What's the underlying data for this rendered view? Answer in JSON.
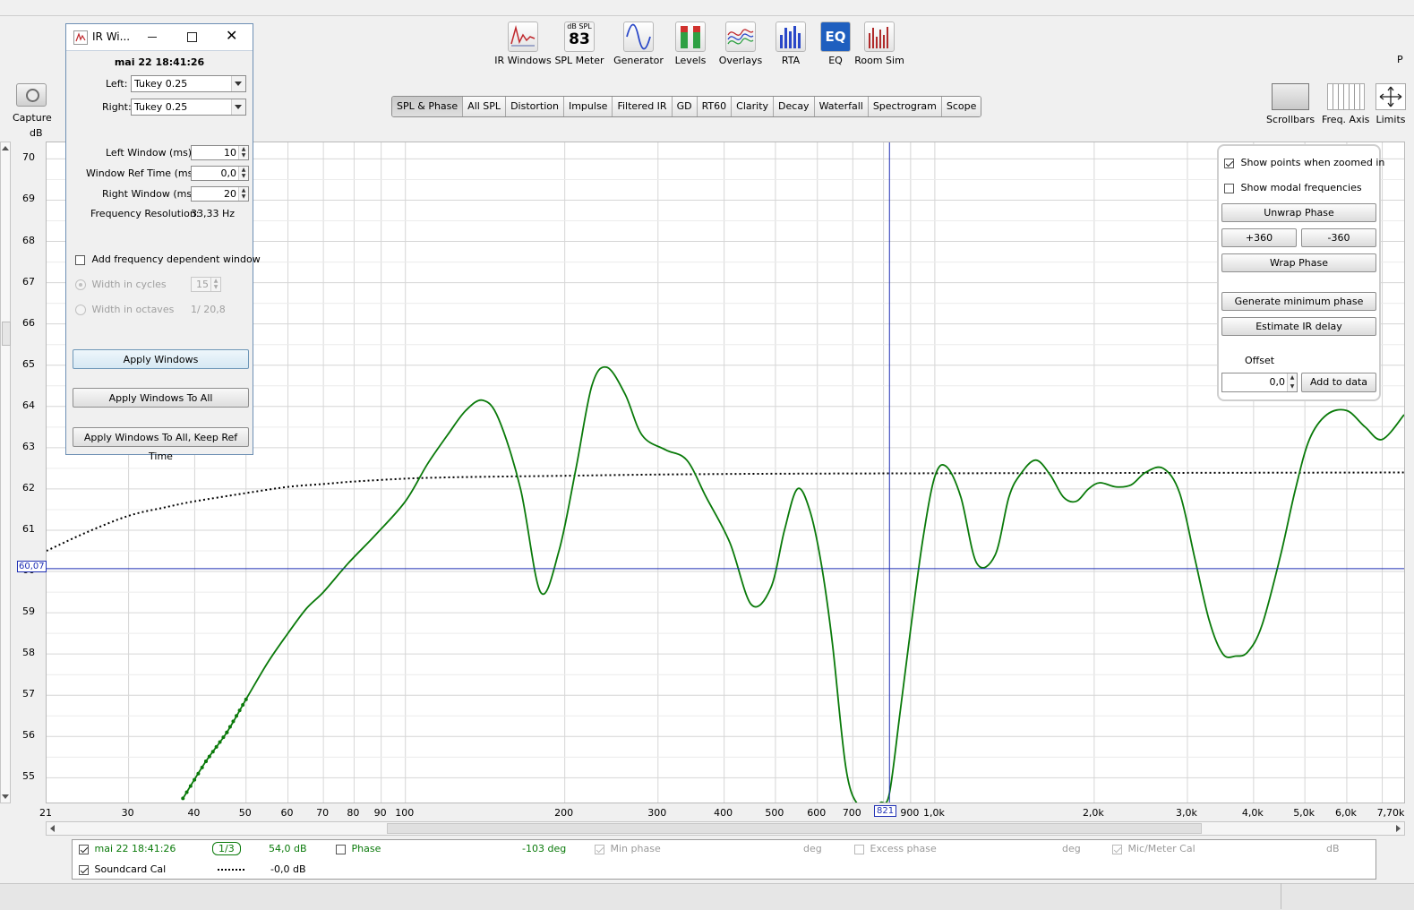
{
  "toolbar": {
    "tools": [
      {
        "label": "IR Windows",
        "icon": "ir-windows-icon"
      },
      {
        "label": "SPL Meter",
        "icon": "spl-meter-icon",
        "meter_top": "dB SPL",
        "meter_value": "83"
      },
      {
        "label": "Generator",
        "icon": "generator-icon"
      },
      {
        "label": "Levels",
        "icon": "levels-icon"
      },
      {
        "label": "Overlays",
        "icon": "overlays-icon"
      },
      {
        "label": "RTA",
        "icon": "rta-icon"
      },
      {
        "label": "EQ",
        "icon": "eq-icon",
        "icon_text": "EQ"
      },
      {
        "label": "Room Sim",
        "icon": "room-sim-icon"
      }
    ],
    "capture": "Capture",
    "truncated_right": "P"
  },
  "tabs": [
    "SPL & Phase",
    "All SPL",
    "Distortion",
    "Impulse",
    "Filtered IR",
    "GD",
    "RT60",
    "Clarity",
    "Decay",
    "Waterfall",
    "Spectrogram",
    "Scope"
  ],
  "active_tab": "SPL & Phase",
  "right_tools": {
    "scrollbars": "Scrollbars",
    "freq_axis": "Freq. Axis",
    "limits": "Limits"
  },
  "chart_data": {
    "type": "line",
    "ylabel": "dB",
    "xscale": "log",
    "xlim": [
      21,
      7700
    ],
    "ylim": [
      54.4,
      70.4
    ],
    "yticks": [
      "70",
      "69",
      "68",
      "67",
      "66",
      "65",
      "64",
      "63",
      "62",
      "61",
      "60",
      "59",
      "58",
      "57",
      "56",
      "55"
    ],
    "xtick_labels": [
      "21",
      "30",
      "40",
      "50",
      "60",
      "70",
      "80",
      "90",
      "100",
      "200",
      "300",
      "400",
      "500",
      "600",
      "700",
      "900",
      "1,0k",
      "2,0k",
      "3,0k",
      "4,0k",
      "5,0k",
      "6,0k",
      "7,70k"
    ],
    "grid": true,
    "cursor": {
      "x_label": "821",
      "y_label": "60,07",
      "x": 821,
      "y": 60.07
    },
    "series": [
      {
        "name": "mai 22 18:41:26",
        "color": "#0a7a0a",
        "style": "solid",
        "x": [
          38,
          42,
          46,
          50,
          55,
          60,
          65,
          70,
          78,
          88,
          100,
          110,
          120,
          130,
          140,
          150,
          165,
          180,
          195,
          210,
          225,
          240,
          260,
          280,
          310,
          340,
          370,
          410,
          450,
          490,
          520,
          550,
          580,
          610,
          640,
          680,
          720,
          760,
          790,
          820,
          860,
          900,
          950,
          1000,
          1050,
          1120,
          1200,
          1300,
          1380,
          1450,
          1550,
          1650,
          1750,
          1850,
          1950,
          2050,
          2200,
          2350,
          2500,
          2700,
          2900,
          3100,
          3300,
          3500,
          3700,
          3900,
          4150,
          4500,
          4800,
          5100,
          5500,
          6000,
          6500,
          7000,
          7700
        ],
        "y": [
          54.5,
          55.4,
          56.1,
          56.9,
          57.8,
          58.5,
          59.1,
          59.5,
          60.2,
          60.9,
          61.7,
          62.6,
          63.3,
          63.9,
          64.15,
          63.7,
          62.0,
          59.5,
          60.5,
          62.5,
          64.5,
          64.95,
          64.3,
          63.3,
          62.95,
          62.7,
          61.8,
          60.7,
          59.2,
          59.6,
          61.0,
          62.0,
          61.5,
          60.2,
          58.3,
          55.2,
          54.3,
          54.3,
          54.4,
          54.6,
          56.6,
          58.6,
          60.8,
          62.3,
          62.55,
          61.8,
          60.2,
          60.4,
          61.8,
          62.35,
          62.7,
          62.35,
          61.8,
          61.7,
          62.0,
          62.15,
          62.05,
          62.1,
          62.4,
          62.5,
          61.9,
          60.3,
          58.8,
          58.0,
          57.95,
          58.05,
          58.7,
          60.4,
          62.0,
          63.2,
          63.8,
          63.9,
          63.5,
          63.2,
          63.8
        ]
      },
      {
        "name": "Soundcard Cal",
        "color": "#000000",
        "style": "dotted",
        "x": [
          21,
          25,
          30,
          35,
          40,
          50,
          60,
          70,
          80,
          100,
          120,
          150,
          200,
          300,
          500,
          1000,
          7700
        ],
        "y": [
          60.5,
          60.95,
          61.35,
          61.55,
          61.7,
          61.9,
          62.05,
          62.12,
          62.18,
          62.25,
          62.28,
          62.3,
          62.32,
          62.35,
          62.37,
          62.38,
          62.4
        ]
      }
    ]
  },
  "legend": {
    "rows": [
      {
        "name": "mai 22 18:41:26",
        "smoothing": "1/3",
        "level": "54,0 dB",
        "checked": true
      },
      {
        "name": "Soundcard Cal",
        "level": "-0,0 dB",
        "checked": true
      }
    ],
    "phase_label": "Phase",
    "phase_value": "-103 deg",
    "min_phase_label": "Min phase",
    "min_phase_unit": "deg",
    "excess_phase_label": "Excess phase",
    "excess_phase_unit": "deg",
    "mic_cal_label": "Mic/Meter Cal",
    "mic_cal_unit": "dB"
  },
  "phase_panel": {
    "show_points": "Show points when zoomed in",
    "show_points_checked": true,
    "show_modal": "Show modal frequencies",
    "show_modal_checked": false,
    "unwrap": "Unwrap Phase",
    "plus360": "+360",
    "minus360": "-360",
    "wrap": "Wrap Phase",
    "gen_min_phase": "Generate minimum phase",
    "estimate_delay": "Estimate IR delay",
    "offset_label": "Offset",
    "offset_value": "0,0",
    "add_to_data": "Add to data"
  },
  "ir_dialog": {
    "title": "IR Wi...",
    "timestamp": "mai 22 18:41:26",
    "left_label": "Left:",
    "left_value": "Tukey 0.25",
    "right_label": "Right:",
    "right_value": "Tukey 0.25",
    "left_window_label": "Left Window (ms):",
    "left_window_value": "10",
    "ref_time_label": "Window Ref Time (ms):",
    "ref_time_value": "0,0",
    "right_window_label": "Right Window (ms):",
    "right_window_value": "20",
    "freq_res_label": "Frequency Resolution:",
    "freq_res_value": "33,33 Hz",
    "add_freq_dep": "Add frequency dependent window",
    "width_cycles": "Width in cycles",
    "width_cycles_value": "15",
    "width_octaves": "Width in octaves",
    "width_octaves_value": "1/ 20,8",
    "apply": "Apply Windows",
    "apply_all": "Apply Windows To All",
    "apply_all_keep": "Apply Windows To All, Keep Ref Time"
  }
}
